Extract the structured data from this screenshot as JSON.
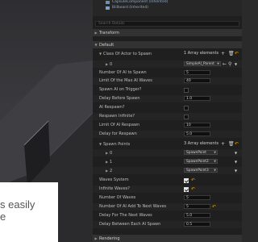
{
  "caption": {
    "line1": "s easily",
    "line2": "e"
  },
  "components": [
    {
      "label": "CapsuleComponent (Inherited)"
    },
    {
      "label": "Billboard (Inherited)"
    }
  ],
  "search_placeholder": "Search Details",
  "sections": {
    "transform": "Transform",
    "default": "Default",
    "rendering": "Rendering"
  },
  "class_array": {
    "label": "Class Of Actor to Spawn",
    "count": "1 Array elements",
    "index": "0",
    "value": "SimpleAI_Parent"
  },
  "props_a": [
    {
      "label": "Number Of AI to Spawn",
      "value": "5"
    },
    {
      "label": "Limit Of the Max AI Waves",
      "value": "40"
    },
    {
      "label": "Spawn AI on Trigger?",
      "checked": false
    },
    {
      "label": "Delay Before Spawn",
      "value": "1.0"
    },
    {
      "label": "AI Respawn?",
      "checked": false
    },
    {
      "label": "Respawn Infinite?",
      "checked": false
    },
    {
      "label": "Limit Of AI Respawn",
      "value": "10"
    },
    {
      "label": "Delay for Respawn",
      "value": "5.0"
    }
  ],
  "spawn_points": {
    "label": "Spawn Points",
    "count": "3 Array elements",
    "items": [
      {
        "index": "0",
        "value": "SpawnPoint"
      },
      {
        "index": "1",
        "value": "SpawnPoint2"
      },
      {
        "index": "2",
        "value": "SpawnPoint3"
      }
    ]
  },
  "props_b": [
    {
      "label": "Waves System",
      "checked": true
    },
    {
      "label": "Infinite Waves?",
      "checked": true
    },
    {
      "label": "Number Of Waves",
      "value": "5"
    },
    {
      "label": "Number Of AI Add To Next Waves",
      "value": "5"
    },
    {
      "label": "Delay For The Next Waves",
      "value": "5.0"
    },
    {
      "label": "Delay Between Each AI Spawn",
      "value": "0.5"
    }
  ],
  "icons": {
    "add": "plus-icon",
    "trash": "trash-icon",
    "reset": "reset-arrow-icon",
    "browse": "browse-arrow-icon",
    "search": "magnifier-icon"
  }
}
